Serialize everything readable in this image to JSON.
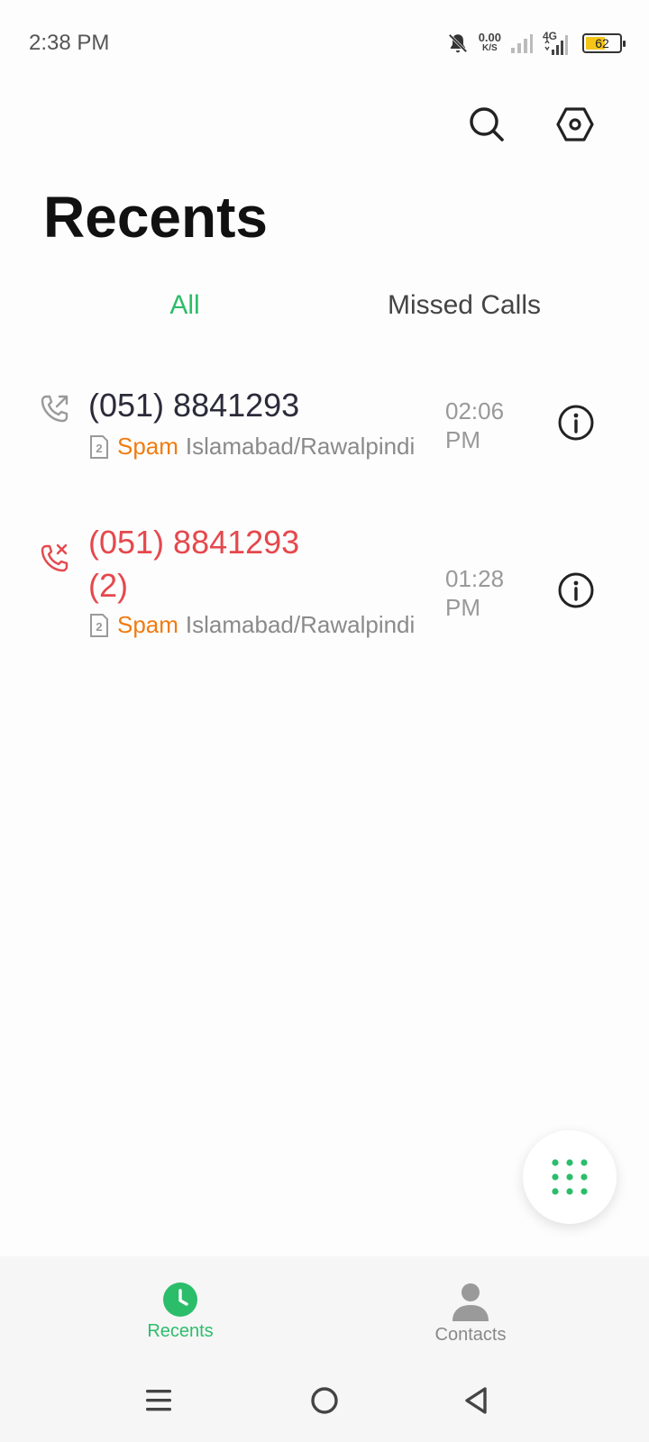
{
  "status_bar": {
    "time": "2:38 PM",
    "net_speed_value": "0.00",
    "net_speed_unit": "K/S",
    "network_type": "4G",
    "battery_level": "62",
    "battery_fraction": 0.62
  },
  "header": {
    "title": "Recents"
  },
  "tabs": [
    {
      "label": "All",
      "active": true
    },
    {
      "label": "Missed Calls",
      "active": false
    }
  ],
  "calls": [
    {
      "number": "(051) 8841293",
      "count": "",
      "type": "outgoing",
      "tag": "Spam",
      "location": "Islamabad/Rawalpindi",
      "sim": "2",
      "time": "02:06",
      "period": "PM"
    },
    {
      "number": "(051) 8841293",
      "count": "(2)",
      "type": "missed",
      "tag": "Spam",
      "location": "Islamabad/Rawalpindi",
      "sim": "2",
      "time": "01:28",
      "period": "PM"
    }
  ],
  "bottom_nav": [
    {
      "label": "Recents",
      "icon": "clock-icon",
      "active": true
    },
    {
      "label": "Contacts",
      "icon": "person-icon",
      "active": false
    }
  ],
  "colors": {
    "accent": "#2cbd6b",
    "missed": "#e5484d",
    "spam": "#f07c10",
    "battery": "#f5c518"
  }
}
